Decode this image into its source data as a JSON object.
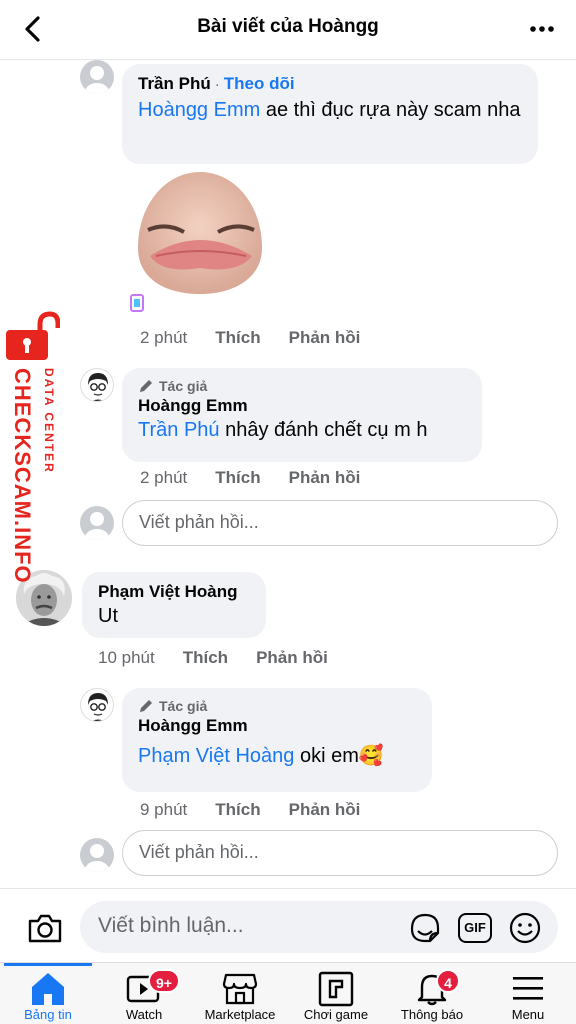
{
  "header": {
    "title": "Bài viết của Hoàngg"
  },
  "comments": [
    {
      "author": "Trần Phú",
      "dot": "·",
      "follow": "Theo dõi",
      "mention": "Hoàngg Emm",
      "text": " ae thì đục rựa này scam nha",
      "time": "2 phút",
      "like": "Thích",
      "reply": "Phản hồi"
    },
    {
      "badge": "Tác giả",
      "author": "Hoàngg Emm",
      "mention": "Trần Phú",
      "text": " nhây đánh chết cụ m h",
      "time": "2 phút",
      "like": "Thích",
      "reply": "Phản hồi"
    },
    {
      "author": "Phạm Việt Hoàng",
      "text": "Ut",
      "time": "10 phút",
      "like": "Thích",
      "reply": "Phản hồi"
    },
    {
      "badge": "Tác giả",
      "author": "Hoàngg Emm",
      "mention": "Phạm Việt Hoàng",
      "text": " oki em🥰",
      "time": "9 phút",
      "like": "Thích",
      "reply": "Phản hồi"
    }
  ],
  "reply_input": {
    "placeholder": "Viết phản hồi..."
  },
  "composer": {
    "placeholder": "Viết bình luận...",
    "gif": "GIF"
  },
  "watermark": {
    "main": "CHECKSCAM.INFO",
    "sub": "DATA CENTER"
  },
  "tabs": [
    {
      "label": "Bảng tin",
      "icon": "home-icon",
      "active": true
    },
    {
      "label": "Watch",
      "icon": "watch-icon",
      "badge": "9+"
    },
    {
      "label": "Marketplace",
      "icon": "marketplace-icon"
    },
    {
      "label": "Chơi game",
      "icon": "gaming-icon"
    },
    {
      "label": "Thông báo",
      "icon": "bell-icon",
      "badge": "4"
    },
    {
      "label": "Menu",
      "icon": "menu-icon"
    }
  ],
  "colors": {
    "accent": "#1877f2",
    "bubble": "#f0f2f5",
    "badge": "#e41e3f",
    "watermark": "#e5251e"
  }
}
